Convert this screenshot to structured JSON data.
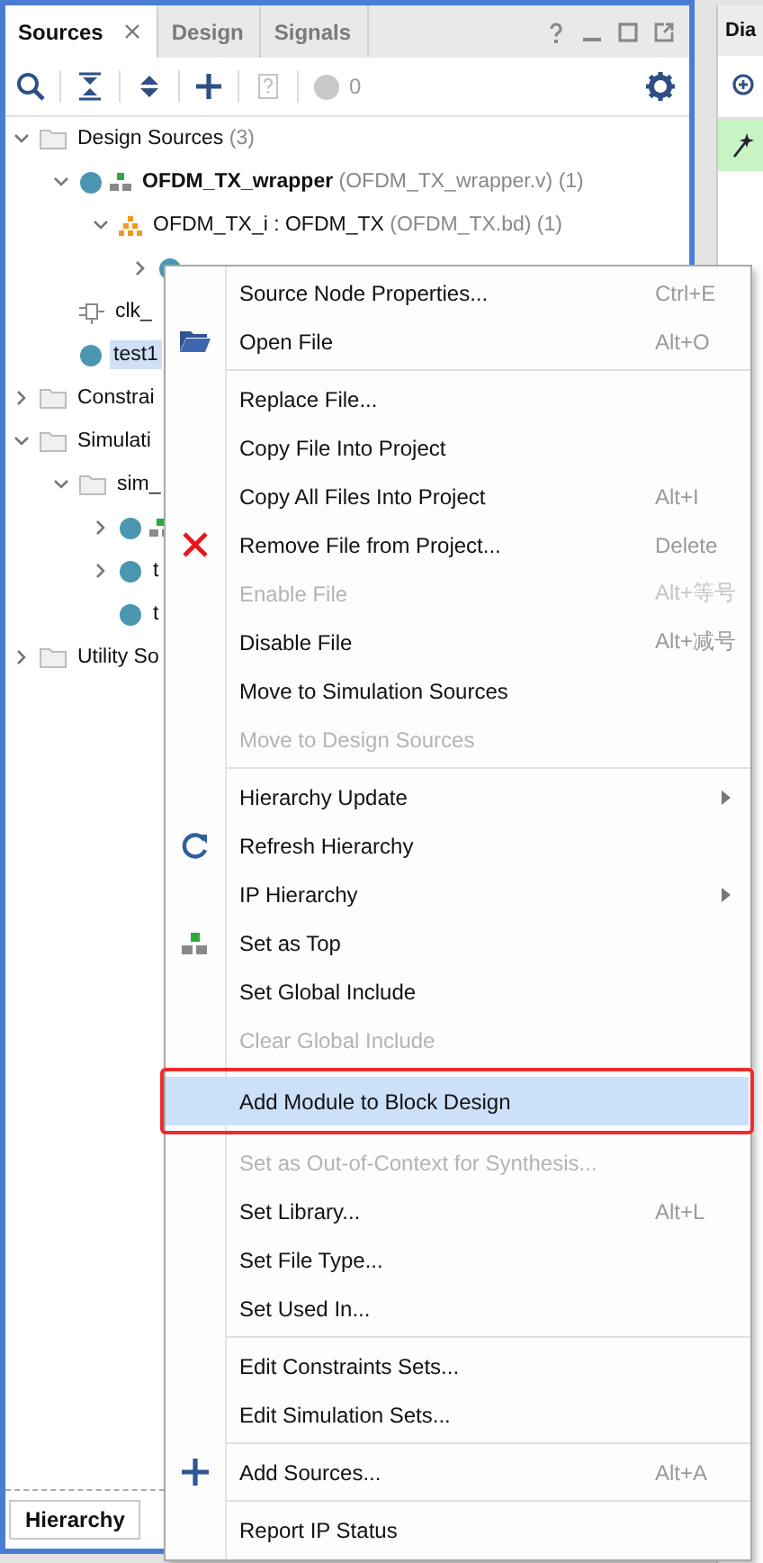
{
  "tabs": [
    {
      "label": "Sources",
      "selected": true,
      "closable": true
    },
    {
      "label": "Design",
      "selected": false
    },
    {
      "label": "Signals",
      "selected": false
    }
  ],
  "toolbar": {
    "count": "0"
  },
  "tree": [
    {
      "label": "Design Sources",
      "note": "(3)",
      "kind": "folder",
      "expanded": true,
      "children": [
        {
          "label": "OFDM_TX_wrapper",
          "note": "(OFDM_TX_wrapper.v) (1)",
          "bold": true,
          "kind": "top",
          "expanded": true,
          "children": [
            {
              "label": "OFDM_TX_i : OFDM_TX",
              "note": "(OFDM_TX.bd) (1)",
              "kind": "bd",
              "expanded": true,
              "children": [
                {
                  "kind": "file",
                  "expanded": false
                }
              ]
            }
          ]
        },
        {
          "label": "clk_",
          "kind": "clock"
        },
        {
          "label": "test1",
          "kind": "file",
          "selected": true
        }
      ]
    },
    {
      "label": "Constrai",
      "kind": "folder",
      "expanded": false
    },
    {
      "label": "Simulati",
      "kind": "folder",
      "expanded": true,
      "children": [
        {
          "label": "sim_",
          "kind": "folder",
          "expanded": true,
          "children": [
            {
              "kind": "top",
              "expanded": false
            },
            {
              "label": "t",
              "kind": "file",
              "expanded": false
            },
            {
              "label": "t",
              "kind": "file"
            }
          ]
        }
      ]
    },
    {
      "label": "Utility So",
      "kind": "folder",
      "expanded": false
    }
  ],
  "bottom_tabs": [
    {
      "label": "Hierarchy",
      "selected": true
    }
  ],
  "right_panel": {
    "tab": "Dia"
  },
  "menu": {
    "items": [
      {
        "kind": "item",
        "label": "Source Node Properties...",
        "shortcut": "Ctrl+E"
      },
      {
        "kind": "item",
        "label": "Open File",
        "shortcut": "Alt+O"
      },
      {
        "kind": "separator"
      },
      {
        "kind": "item",
        "label": "Replace File..."
      },
      {
        "kind": "item",
        "label": "Copy File Into Project"
      },
      {
        "kind": "item",
        "label": "Copy All Files Into Project",
        "shortcut": "Alt+I"
      },
      {
        "kind": "item",
        "label": "Remove File from Project...",
        "shortcut": "Delete"
      },
      {
        "kind": "item",
        "label": "Enable File",
        "shortcut": "Alt+等号",
        "disabled": true
      },
      {
        "kind": "item",
        "label": "Disable File",
        "shortcut": "Alt+减号"
      },
      {
        "kind": "item",
        "label": "Move to Simulation Sources"
      },
      {
        "kind": "item",
        "label": "Move to Design Sources",
        "disabled": true
      },
      {
        "kind": "separator"
      },
      {
        "kind": "item",
        "label": "Hierarchy Update",
        "submenu": true
      },
      {
        "kind": "item",
        "label": "Refresh Hierarchy"
      },
      {
        "kind": "item",
        "label": "IP Hierarchy",
        "submenu": true
      },
      {
        "kind": "item",
        "label": "Set as Top"
      },
      {
        "kind": "item",
        "label": "Set Global Include"
      },
      {
        "kind": "item",
        "label": "Clear Global Include",
        "disabled": true
      },
      {
        "kind": "separator"
      },
      {
        "kind": "item",
        "label": "Add Module to Block Design",
        "selected": true,
        "outlined": true
      },
      {
        "kind": "separator"
      },
      {
        "kind": "item",
        "label": "Set as Out-of-Context for Synthesis...",
        "disabled": true
      },
      {
        "kind": "item",
        "label": "Set Library...",
        "shortcut": "Alt+L"
      },
      {
        "kind": "item",
        "label": "Set File Type..."
      },
      {
        "kind": "item",
        "label": "Set Used In..."
      },
      {
        "kind": "separator"
      },
      {
        "kind": "item",
        "label": "Edit Constraints Sets..."
      },
      {
        "kind": "item",
        "label": "Edit Simulation Sets..."
      },
      {
        "kind": "separator"
      },
      {
        "kind": "item",
        "label": "Add Sources...",
        "shortcut": "Alt+A"
      },
      {
        "kind": "separator"
      },
      {
        "kind": "item",
        "label": "Report IP Status"
      }
    ]
  }
}
